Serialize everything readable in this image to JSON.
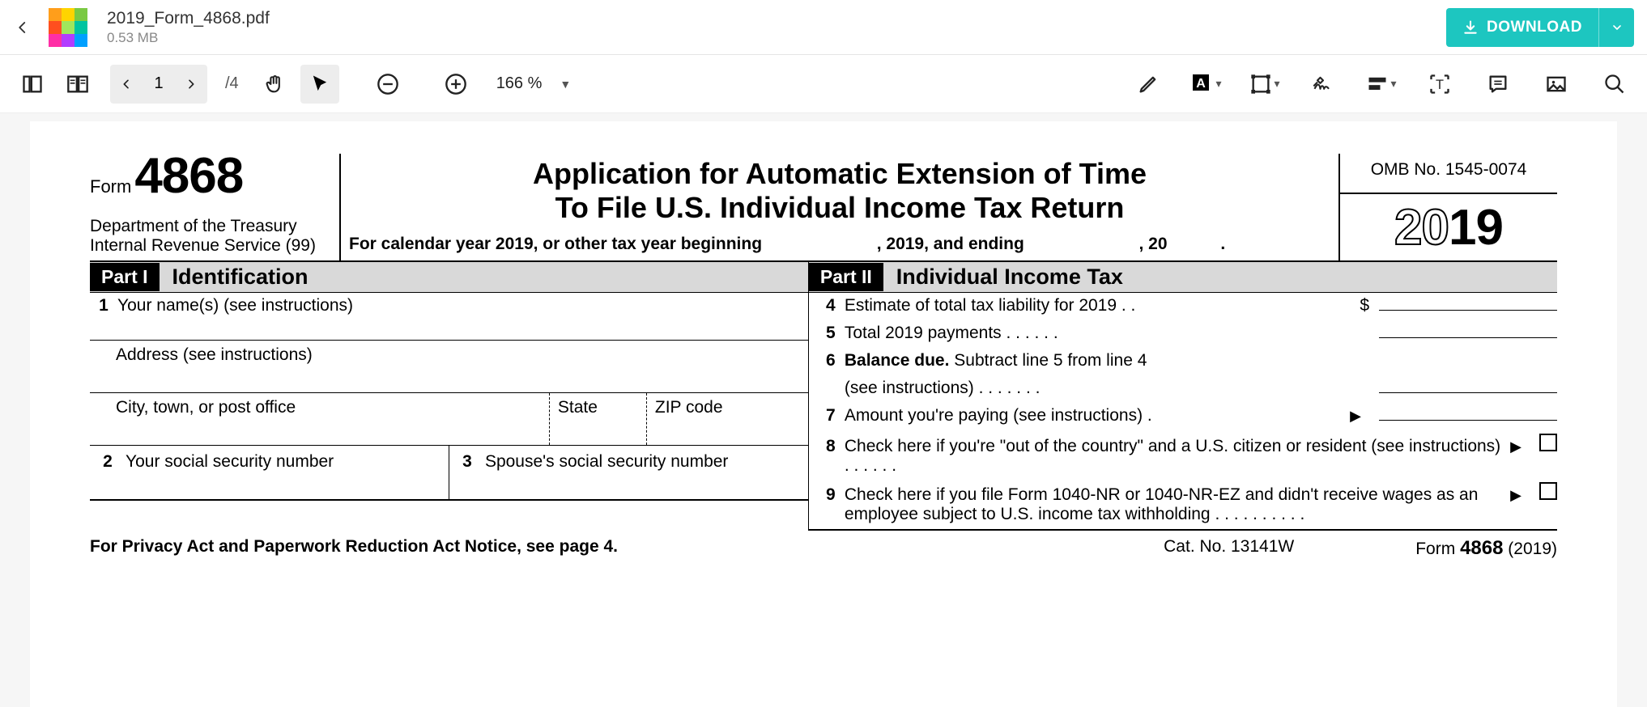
{
  "header": {
    "file_name": "2019_Form_4868.pdf",
    "file_size": "0.53 MB",
    "download_label": "DOWNLOAD"
  },
  "toolbar": {
    "page_current": "1",
    "page_total": "/4",
    "zoom": "166 %"
  },
  "form": {
    "form_label": "Form",
    "form_number": "4868",
    "dept": "Department of the Treasury",
    "irs": "Internal Revenue Service (99)",
    "title_line1": "Application for Automatic Extension of Time",
    "title_line2": "To File U.S. Individual Income Tax Return",
    "cy_prefix": "For calendar year 2019, or other tax year beginning",
    "cy_mid": ", 2019, and ending",
    "cy_suffix": ", 20",
    "omb": "OMB No. 1545-0074",
    "year_outline": "20",
    "year_bold": "19",
    "part1_tag": "Part I",
    "part1_title": "Identification",
    "part2_tag": "Part II",
    "part2_title": "Individual Income Tax",
    "line1_num": "1",
    "line1": "Your name(s) (see instructions)",
    "address": "Address (see instructions)",
    "city": "City, town, or post office",
    "state": "State",
    "zip": "ZIP code",
    "line2_num": "2",
    "line2": "Your social security number",
    "line3_num": "3",
    "line3": "Spouse's social security number",
    "line4_num": "4",
    "line4": "Estimate of total tax liability for 2019 .   .",
    "dollar": "$",
    "line5_num": "5",
    "line5": "Total 2019 payments   .   .   .   .   .   .",
    "line6_num": "6",
    "line6a": "Balance due.",
    "line6b": " Subtract line 5 from line 4",
    "line6c": "(see instructions)   .   .   .   .   .   .   .",
    "line7_num": "7",
    "line7": "Amount you're paying (see instructions) .",
    "line8_num": "8",
    "line8": "Check here if you're \"out of the country\" and a U.S. citizen or resident (see instructions)  .   .   .   .   .   . ",
    "line9_num": "9",
    "line9": "Check here if you file Form 1040-NR or 1040-NR-EZ and didn't receive wages as an employee subject to U.S. income tax withholding .   .   .   .   .   .   .   .   .   .",
    "footer_left": "For Privacy Act and Paperwork Reduction Act Notice, see page 4.",
    "footer_mid": "Cat. No. 13141W",
    "footer_right_a": "Form ",
    "footer_right_b": "4868",
    "footer_right_c": " (2019)"
  }
}
